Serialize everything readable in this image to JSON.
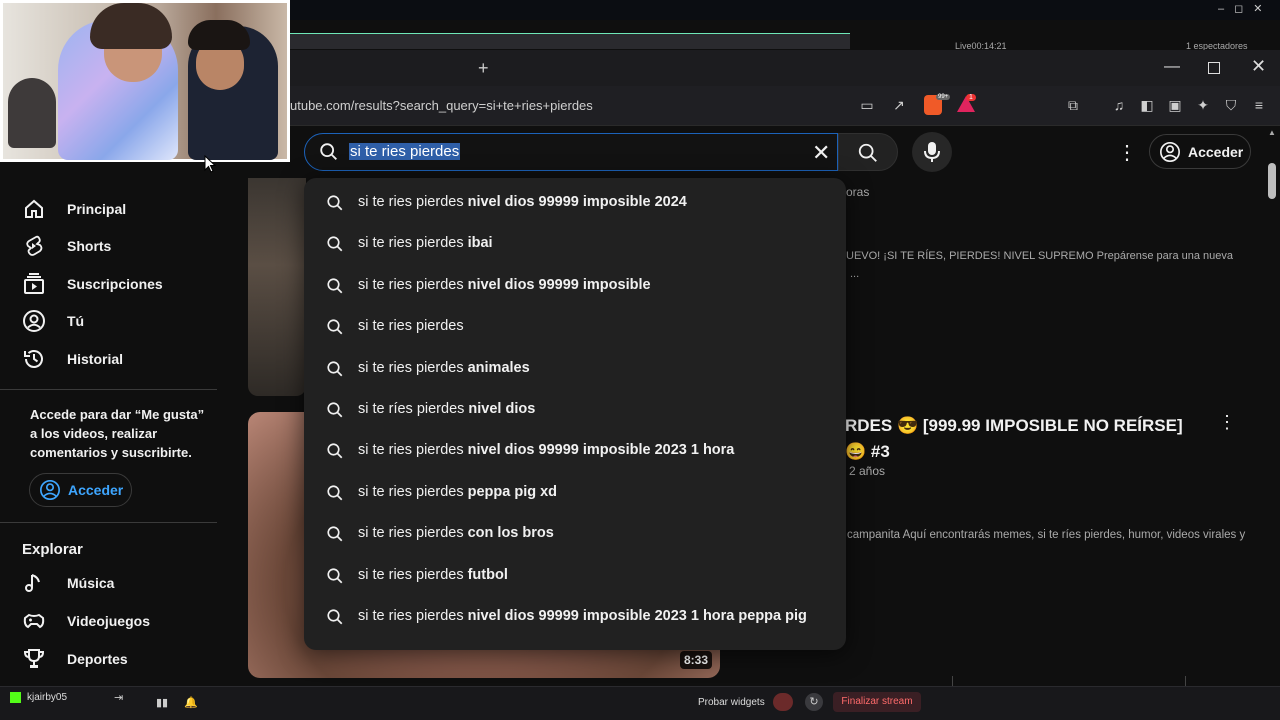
{
  "stream_overlay": {
    "live_timer": "Live00:14:21",
    "viewers": "1 espectadores",
    "username": "kjairby05",
    "widgets_label": "Probar widgets",
    "end_stream_label": "Finalizar stream"
  },
  "browser": {
    "url": "utube.com/results?search_query=si+te+ries+pierdes",
    "new_tab_symbol": "+",
    "shields_count": "99+",
    "rewards_count": "1"
  },
  "header": {
    "search_value": "si te ries pierdes",
    "signin_label": "Acceder"
  },
  "sidebar": {
    "items": [
      {
        "label": "Principal",
        "icon": "home-icon"
      },
      {
        "label": "Shorts",
        "icon": "shorts-icon"
      },
      {
        "label": "Suscripciones",
        "icon": "subscriptions-icon"
      },
      {
        "label": "Tú",
        "icon": "user-icon"
      },
      {
        "label": "Historial",
        "icon": "history-icon"
      }
    ],
    "signin_message": "Accede para dar “Me gusta” a los videos, realizar comentarios y suscribirte.",
    "signin_label": "Acceder",
    "explore_heading": "Explorar",
    "explore_items": [
      {
        "label": "Música",
        "icon": "music-icon"
      },
      {
        "label": "Videojuegos",
        "icon": "gaming-icon"
      },
      {
        "label": "Deportes",
        "icon": "trophy-icon"
      }
    ]
  },
  "suggestions": [
    {
      "prefix": "si te ries pierdes",
      "rest": " nivel dios 99999 imposible 2024"
    },
    {
      "prefix": "si te ries pierdes",
      "rest": " ibai"
    },
    {
      "prefix": "si te ries pierdes",
      "rest": " nivel dios 99999 imposible"
    },
    {
      "prefix": "si te ries pierdes",
      "rest": ""
    },
    {
      "prefix": "si te ries pierdes",
      "rest": " animales"
    },
    {
      "prefix": "si te ríes pierdes",
      "rest": " nivel dios"
    },
    {
      "prefix": "si te ries pierdes",
      "rest": " nivel dios 99999 imposible 2023 1 hora"
    },
    {
      "prefix": "si te ries pierdes",
      "rest": " peppa pig xd"
    },
    {
      "prefix": "si te ries pierdes",
      "rest": " con los bros"
    },
    {
      "prefix": "si te ries pierdes",
      "rest": " futbol"
    },
    {
      "prefix": "si te ries pierdes",
      "rest": " nivel dios 99999 imposible 2023 1 hora peppa pig"
    }
  ],
  "results": {
    "r1_meta_partial": "oras",
    "r1_desc_partial": "UEVO! ¡SI TE RÍES, PIERDES! NIVEL SUPREMO Prepárense para una nueva",
    "r1_ellipsis": "...",
    "r2_title_partial": "RDES 😎 [999.99 IMPOSIBLE NO REÍRSE] 😄 #3",
    "r2_meta_partial": "2 años",
    "r2_desc_partial": "campanita Aquí encontrarás memes, si te ríes pierdes, humor, videos virales y",
    "r2_duration": "8:33"
  }
}
